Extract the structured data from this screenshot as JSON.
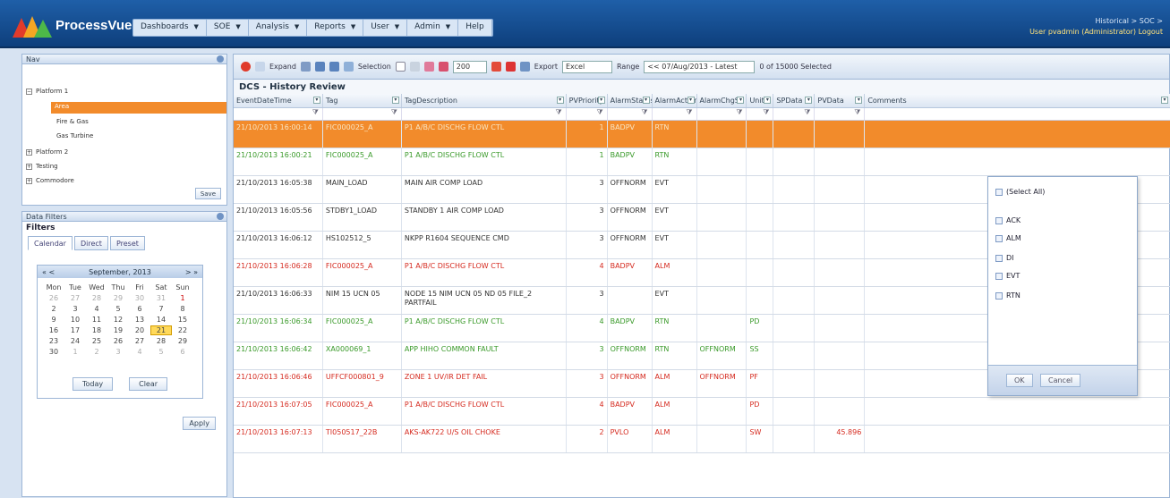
{
  "app": {
    "brand": "ProcessVue",
    "breadcrumb": "Historical > SOC >",
    "user": "User pvadmin (Administrator)",
    "logout": "Logout"
  },
  "menus": [
    {
      "label": "Dashboards"
    },
    {
      "label": "SOE"
    },
    {
      "label": "Analysis"
    },
    {
      "label": "Reports"
    },
    {
      "label": "User"
    },
    {
      "label": "Admin"
    },
    {
      "label": "Help"
    }
  ],
  "colors": {
    "accent": "#f28b2b",
    "green": "#3a9a2a",
    "red": "#d52a1f",
    "topbar": "#1b5598"
  },
  "nav": {
    "header": "Nav",
    "save": "Save",
    "tree": [
      "Platform 1",
      "Area",
      "Fire & Gas",
      "Gas Turbine",
      "Platform 2",
      "Testing",
      "Commodore"
    ]
  },
  "filters": {
    "header": "Data Filters",
    "title": "Filters",
    "tabs": [
      "Calendar",
      "Direct",
      "Preset"
    ],
    "calendar": {
      "prev_year": "«",
      "prev_month": "<",
      "next_month": ">",
      "next_year": "»",
      "month": "September, 2013",
      "days": [
        "Mon",
        "Tue",
        "Wed",
        "Thu",
        "Fri",
        "Sat",
        "Sun"
      ],
      "weeks": [
        [
          "26",
          "27",
          "28",
          "29",
          "30",
          "31",
          "1"
        ],
        [
          "2",
          "3",
          "4",
          "5",
          "6",
          "7",
          "8"
        ],
        [
          "9",
          "10",
          "11",
          "12",
          "13",
          "14",
          "15"
        ],
        [
          "16",
          "17",
          "18",
          "19",
          "20",
          "21",
          "22"
        ],
        [
          "23",
          "24",
          "25",
          "26",
          "27",
          "28",
          "29"
        ],
        [
          "30",
          "1",
          "2",
          "3",
          "4",
          "5",
          "6"
        ]
      ],
      "today": "Today",
      "clear": "Clear"
    },
    "apply": "Apply"
  },
  "toolbar": {
    "expand": "Expand",
    "selection": "Selection",
    "page": "200",
    "export": "Export",
    "format": "Excel",
    "range": "Range",
    "range_value": "<< 07/Aug/2013 - Latest",
    "selected": "0 of 15000 Selected"
  },
  "grid": {
    "title": "DCS - History Review",
    "columns": [
      "EventDateTime",
      "Tag",
      "TagDescription",
      "PVPriority",
      "AlarmStatus",
      "AlarmAction",
      "AlarmChgSt",
      "Unit",
      "SPData",
      "PVData",
      "Comments"
    ],
    "rows": [
      {
        "dt": "21/10/2013 16:00:14",
        "tag": "FIC000025_A",
        "desc": "P1 A/B/C DISCHG FLOW CTL",
        "pri": "1",
        "status": "BADPV",
        "action": "RTN",
        "chg": "",
        "unit": "",
        "sp": "",
        "pv": "",
        "c": "",
        "style": "sel"
      },
      {
        "dt": "21/10/2013 16:00:21",
        "tag": "FIC000025_A",
        "desc": "P1 A/B/C DISCHG FLOW CTL",
        "pri": "1",
        "status": "BADPV",
        "action": "RTN",
        "chg": "",
        "unit": "",
        "sp": "",
        "pv": "",
        "c": "",
        "style": "g"
      },
      {
        "dt": "21/10/2013 16:05:38",
        "tag": "MAIN_LOAD",
        "desc": "MAIN AIR COMP LOAD",
        "pri": "3",
        "status": "OFFNORM",
        "action": "EVT",
        "chg": "",
        "unit": "",
        "sp": "",
        "pv": "",
        "c": "",
        "style": "n"
      },
      {
        "dt": "21/10/2013 16:05:56",
        "tag": "STDBY1_LOAD",
        "desc": "STANDBY 1 AIR COMP LOAD",
        "pri": "3",
        "status": "OFFNORM",
        "action": "EVT",
        "chg": "",
        "unit": "",
        "sp": "",
        "pv": "",
        "c": "",
        "style": "n"
      },
      {
        "dt": "21/10/2013 16:06:12",
        "tag": "HS102512_5",
        "desc": "NKPP R1604 SEQUENCE CMD",
        "pri": "3",
        "status": "OFFNORM",
        "action": "EVT",
        "chg": "",
        "unit": "",
        "sp": "",
        "pv": "",
        "c": "",
        "style": "n"
      },
      {
        "dt": "21/10/2013 16:06:28",
        "tag": "FIC000025_A",
        "desc": "P1 A/B/C DISCHG FLOW CTL",
        "pri": "4",
        "status": "BADPV",
        "action": "ALM",
        "chg": "",
        "unit": "",
        "sp": "",
        "pv": "",
        "c": "",
        "style": "r"
      },
      {
        "dt": "21/10/2013 16:06:33",
        "tag": "NIM 15 UCN 05",
        "desc": "NODE 15 NIM UCN 05 ND 05 FILE_2 PARTFAIL",
        "pri": "3",
        "status": "",
        "action": "EVT",
        "chg": "",
        "unit": "",
        "sp": "",
        "pv": "",
        "c": "",
        "style": "n"
      },
      {
        "dt": "21/10/2013 16:06:34",
        "tag": "FIC000025_A",
        "desc": "P1 A/B/C DISCHG FLOW CTL",
        "pri": "4",
        "status": "BADPV",
        "action": "RTN",
        "chg": "",
        "unit": "PD",
        "sp": "",
        "pv": "",
        "c": "",
        "style": "g"
      },
      {
        "dt": "21/10/2013 16:06:42",
        "tag": "XA000069_1",
        "desc": "APP HIHO COMMON FAULT",
        "pri": "3",
        "status": "OFFNORM",
        "action": "RTN",
        "chg": "OFFNORM",
        "unit": "SS",
        "sp": "",
        "pv": "",
        "c": "",
        "style": "g"
      },
      {
        "dt": "21/10/2013 16:06:46",
        "tag": "UFFCF000801_9",
        "desc": "ZONE 1 UV/IR DET FAIL",
        "pri": "3",
        "status": "OFFNORM",
        "action": "ALM",
        "chg": "OFFNORM",
        "unit": "PF",
        "sp": "",
        "pv": "",
        "c": "",
        "style": "r"
      },
      {
        "dt": "21/10/2013 16:07:05",
        "tag": "FIC000025_A",
        "desc": "P1 A/B/C DISCHG FLOW CTL",
        "pri": "4",
        "status": "BADPV",
        "action": "ALM",
        "chg": "",
        "unit": "PD",
        "sp": "",
        "pv": "",
        "c": "",
        "style": "r"
      },
      {
        "dt": "21/10/2013 16:07:13",
        "tag": "TI050517_22B",
        "desc": "AKS-AK722 U/S OIL CHOKE",
        "pri": "2",
        "status": "PVLO",
        "action": "ALM",
        "chg": "",
        "unit": "SW",
        "sp": "",
        "pv": "45.896",
        "c": "",
        "style": "r"
      }
    ]
  },
  "dropdown": {
    "select_all": "(Select All)",
    "options": [
      "ACK",
      "ALM",
      "DI",
      "EVT",
      "RTN"
    ],
    "ok": "OK",
    "cancel": "Cancel"
  }
}
